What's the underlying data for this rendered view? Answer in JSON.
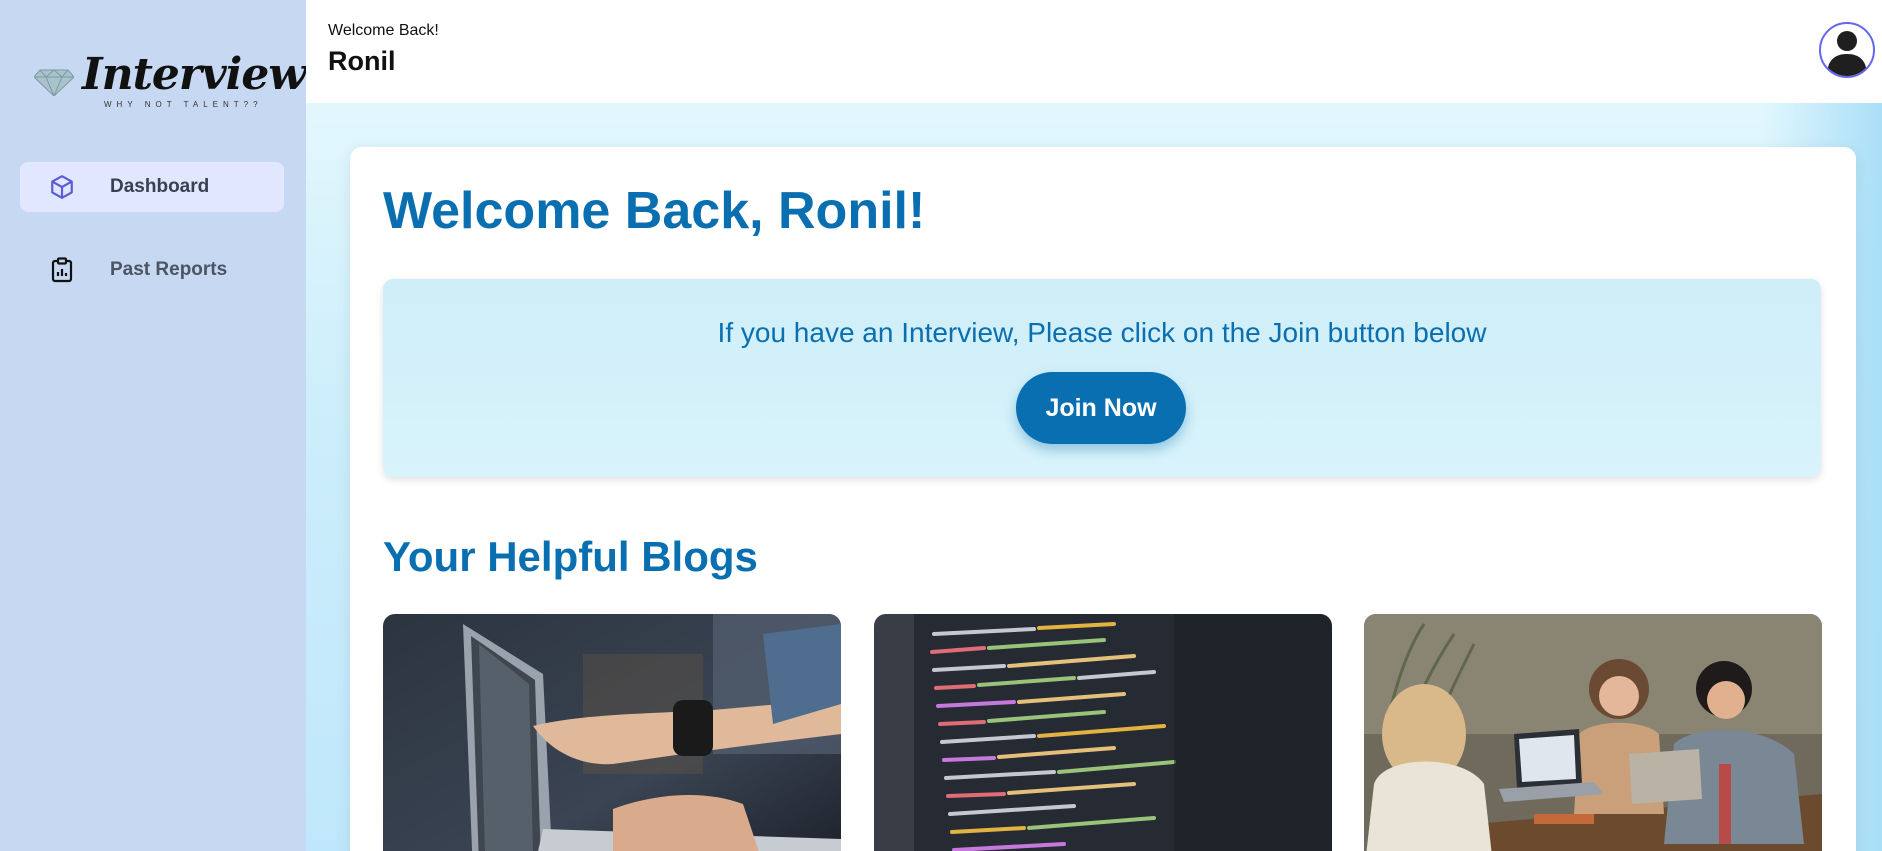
{
  "brand": {
    "name": "Interview Ji",
    "tagline": "WHY NOT TALENT??",
    "icon": "diamond-logo-icon"
  },
  "sidebar": {
    "items": [
      {
        "label": "Dashboard",
        "icon": "cube-icon",
        "active": true
      },
      {
        "label": "Past Reports",
        "icon": "clipboard-chart-icon",
        "active": false
      }
    ]
  },
  "header": {
    "greeting": "Welcome Back!",
    "user_name": "Ronil",
    "avatar_icon": "user-avatar-icon"
  },
  "main": {
    "title": "Welcome Back, Ronil!",
    "join": {
      "message": "If you have an Interview, Please click on the Join button below",
      "button_label": "Join Now"
    },
    "blogs_title": "Your Helpful Blogs",
    "blogs": [
      {
        "image": "laptop-pointing-photo"
      },
      {
        "image": "code-screen-photo"
      },
      {
        "image": "people-at-table-photo"
      }
    ]
  },
  "colors": {
    "accent": "#0a6fb0",
    "sidebar_bg": "#c7d8f2",
    "active_nav_bg": "#e0e7ff",
    "avatar_ring": "#6366f1"
  }
}
